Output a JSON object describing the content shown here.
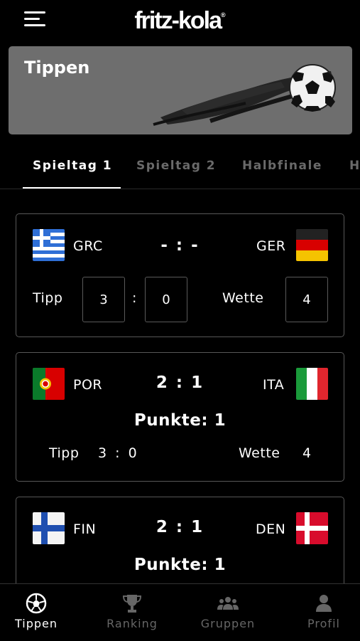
{
  "header": {
    "brand": "fritz-kola",
    "brand_mark": "®",
    "menu_icon": "hamburger-menu-icon"
  },
  "banner": {
    "title": "Tippen",
    "art_icon": "soccer-ball-icon"
  },
  "tabs": [
    {
      "label": "Spieltag 1",
      "active": true
    },
    {
      "label": "Spieltag 2",
      "active": false
    },
    {
      "label": "Halbfinale",
      "active": false
    },
    {
      "label": "H",
      "active": false
    }
  ],
  "matches": [
    {
      "home": {
        "code": "GRC",
        "flag": "greece-flag-icon"
      },
      "away": {
        "code": "GER",
        "flag": "germany-flag-icon"
      },
      "score": "- : -",
      "tipp_label": "Tipp",
      "tipp_home": "3",
      "tipp_sep": ":",
      "tipp_away": "0",
      "wette_label": "Wette",
      "wette_value": "4"
    },
    {
      "home": {
        "code": "POR",
        "flag": "portugal-flag-icon"
      },
      "away": {
        "code": "ITA",
        "flag": "italy-flag-icon"
      },
      "score": "2 : 1",
      "points": "Punkte: 1",
      "tipp_label": "Tipp",
      "tipp_value": "3 : 0",
      "wette_label": "Wette",
      "wette_value": "4"
    },
    {
      "home": {
        "code": "FIN",
        "flag": "finland-flag-icon"
      },
      "away": {
        "code": "DEN",
        "flag": "denmark-flag-icon"
      },
      "score": "2 : 1",
      "points": "Punkte: 1"
    }
  ],
  "bottom_nav": [
    {
      "label": "Tippen",
      "icon": "soccer-ball-icon",
      "active": true
    },
    {
      "label": "Ranking",
      "icon": "trophy-icon",
      "active": false
    },
    {
      "label": "Gruppen",
      "icon": "group-icon",
      "active": false
    },
    {
      "label": "Profil",
      "icon": "person-icon",
      "active": false
    }
  ],
  "colors": {
    "background": "#000000",
    "banner": "#6e6e6e",
    "inactive": "#666666",
    "border": "#575757"
  }
}
